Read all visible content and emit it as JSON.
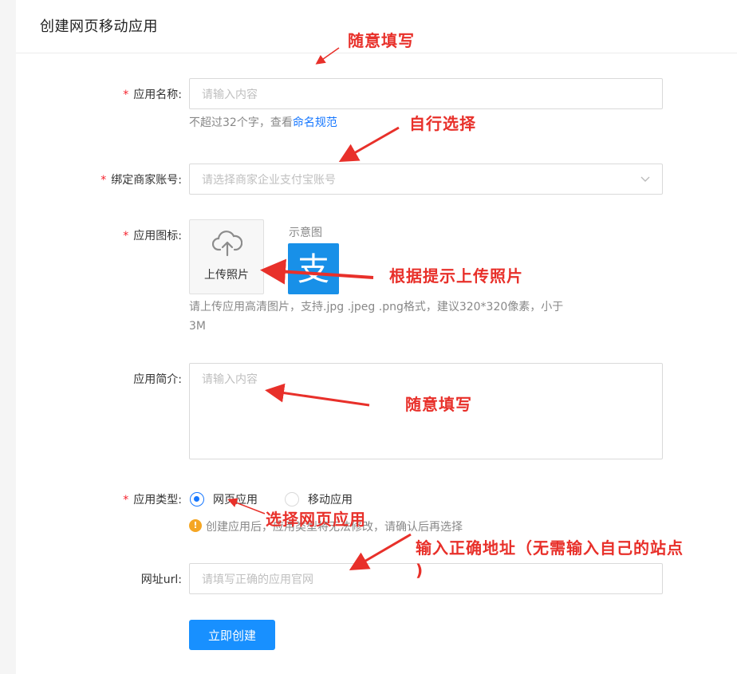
{
  "page_title": "创建网页移动应用",
  "form": {
    "app_name": {
      "label": "应用名称:",
      "placeholder": "请输入内容",
      "hint_prefix": "不超过32个字，查看",
      "hint_link": "命名规范"
    },
    "merchant": {
      "label": "绑定商家账号:",
      "placeholder": "请选择商家企业支付宝账号"
    },
    "icon": {
      "label": "应用图标:",
      "upload_label": "上传照片",
      "demo_label": "示意图",
      "demo_glyph": "支",
      "hint_line1": "请上传应用高清图片，支持.jpg .jpeg .png格式，建议320*320像素，小于",
      "hint_line2": "3M"
    },
    "intro": {
      "label": "应用简介:",
      "placeholder": "请输入内容"
    },
    "type": {
      "label": "应用类型:",
      "options": [
        "网页应用",
        "移动应用"
      ],
      "selected": "网页应用",
      "warning": "创建应用后，应用类型将无法修改，请确认后再选择"
    },
    "url": {
      "label": "网址url:",
      "placeholder": "请填写正确的应用官网"
    },
    "submit_label": "立即创建",
    "required_mark": "*"
  },
  "annotations": {
    "a1": "随意填写",
    "a2": "自行选择",
    "a3": "根据提示上传照片",
    "a4": "随意填写",
    "a5": "选择网页应用",
    "a6_line1": "输入正确地址（无需输入自己的站点",
    "a6_line2": ")"
  },
  "colors": {
    "primary": "#1890ff",
    "annotation": "#e8302a",
    "required": "#f5222d",
    "warning": "#f5a623"
  }
}
